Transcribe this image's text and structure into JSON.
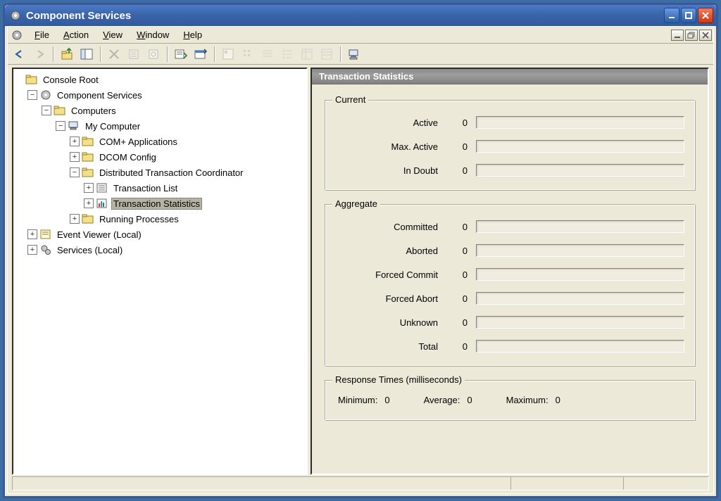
{
  "window": {
    "title": "Component Services"
  },
  "menu": {
    "file": "File",
    "action": "Action",
    "view": "View",
    "window": "Window",
    "help": "Help"
  },
  "tree": {
    "console_root": "Console Root",
    "component_services": "Component Services",
    "computers": "Computers",
    "my_computer": "My Computer",
    "com_plus": "COM+ Applications",
    "dcom_config": "DCOM Config",
    "dtc": "Distributed Transaction Coordinator",
    "tx_list": "Transaction List",
    "tx_stats": "Transaction Statistics",
    "running_procs": "Running Processes",
    "event_viewer": "Event Viewer (Local)",
    "services": "Services (Local)"
  },
  "pane": {
    "header": "Transaction Statistics",
    "current": {
      "legend": "Current",
      "active_label": "Active",
      "active": "0",
      "max_active_label": "Max. Active",
      "max_active": "0",
      "in_doubt_label": "In Doubt",
      "in_doubt": "0"
    },
    "aggregate": {
      "legend": "Aggregate",
      "committed_label": "Committed",
      "committed": "0",
      "aborted_label": "Aborted",
      "aborted": "0",
      "forced_commit_label": "Forced Commit",
      "forced_commit": "0",
      "forced_abort_label": "Forced Abort",
      "forced_abort": "0",
      "unknown_label": "Unknown",
      "unknown": "0",
      "total_label": "Total",
      "total": "0"
    },
    "response": {
      "legend": "Response Times (milliseconds)",
      "min_label": "Minimum:",
      "min": "0",
      "avg_label": "Average:",
      "avg": "0",
      "max_label": "Maximum:",
      "max": "0"
    }
  }
}
